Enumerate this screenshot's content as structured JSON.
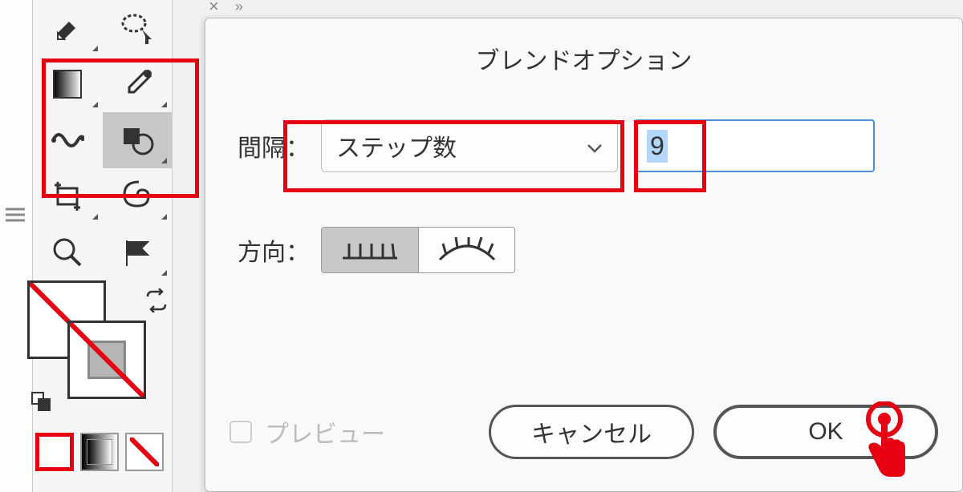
{
  "dialog": {
    "title": "ブレンドオプション",
    "spacing_label": "間隔：",
    "spacing_dropdown": "ステップ数",
    "spacing_value": "9",
    "direction_label": "方向：",
    "preview_label": "プレビュー",
    "cancel_label": "キャンセル",
    "ok_label": "OK"
  },
  "tab": {
    "close": "×",
    "more": "»"
  }
}
